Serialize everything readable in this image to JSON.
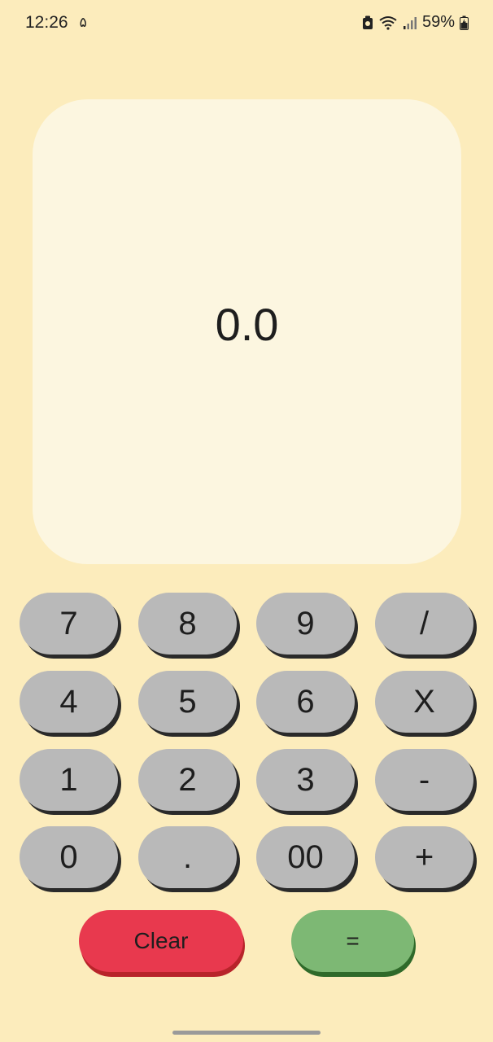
{
  "status_bar": {
    "time": "12:26",
    "notification": "۵",
    "battery": "59%"
  },
  "display": {
    "value": "0.0"
  },
  "keypad": {
    "row1": [
      "7",
      "8",
      "9",
      "/"
    ],
    "row2": [
      "4",
      "5",
      "6",
      "X"
    ],
    "row3": [
      "1",
      "2",
      "3",
      "-"
    ],
    "row4": [
      "0",
      ".",
      "00",
      "+"
    ]
  },
  "actions": {
    "clear_label": "Clear",
    "equals_label": "="
  },
  "colors": {
    "background": "#fcecbc",
    "display": "#fcf6e0",
    "key": "#b9b9b9",
    "clear": "#e8394e",
    "equals": "#7db874"
  }
}
